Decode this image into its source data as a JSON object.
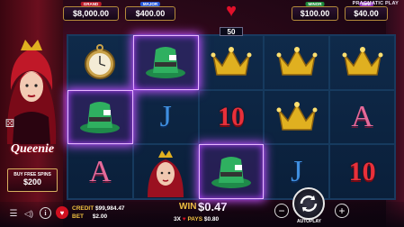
{
  "jackpots": {
    "grand": {
      "tag": "GRAND",
      "value": "$8,000.00",
      "color": "#b81c2a"
    },
    "major": {
      "tag": "MAJOR",
      "value": "$400.00",
      "color": "#2a5ad8"
    },
    "minor": {
      "tag": "MINOR",
      "value": "$100.00",
      "color": "#1d8a3a"
    },
    "mini": {
      "tag": "MINI",
      "value": "$40.00",
      "color": "#8a2ab8"
    }
  },
  "multiplier_badge": "50",
  "brand": "PRAGMATIC PLAY",
  "character": {
    "name": "Queenie"
  },
  "buy_free_spins": {
    "label": "BUY FREE SPINS",
    "price": "$200"
  },
  "reels": [
    [
      "watch",
      "hat",
      "crown",
      "crown",
      "crown"
    ],
    [
      "hat",
      "J",
      "10",
      "crown",
      "A"
    ],
    [
      "A",
      "queen",
      "hat",
      "J",
      "10"
    ]
  ],
  "winning_cells": [
    [
      0,
      1
    ],
    [
      1,
      0
    ],
    [
      2,
      2
    ]
  ],
  "symbol_text": {
    "J": "J",
    "A": "A",
    "10": "10"
  },
  "status": {
    "credit_label": "CREDIT",
    "credit_value": "$99,984.47",
    "bet_label": "BET",
    "bet_value": "$2.00",
    "win_label": "WIN",
    "win_value": "$0.47",
    "pays_multiplier": "3X",
    "pays_label": "PAYS",
    "pays_value": "$0.80"
  },
  "controls": {
    "minus": "−",
    "plus": "+",
    "autoplay_label": "AUTOPLAY"
  },
  "icons": [
    "menu-icon",
    "sound-icon",
    "info-icon",
    "dice-icon",
    "heart-icon"
  ],
  "colors": {
    "accent_gold": "#f0c040",
    "win_glow": "#c050ff"
  }
}
